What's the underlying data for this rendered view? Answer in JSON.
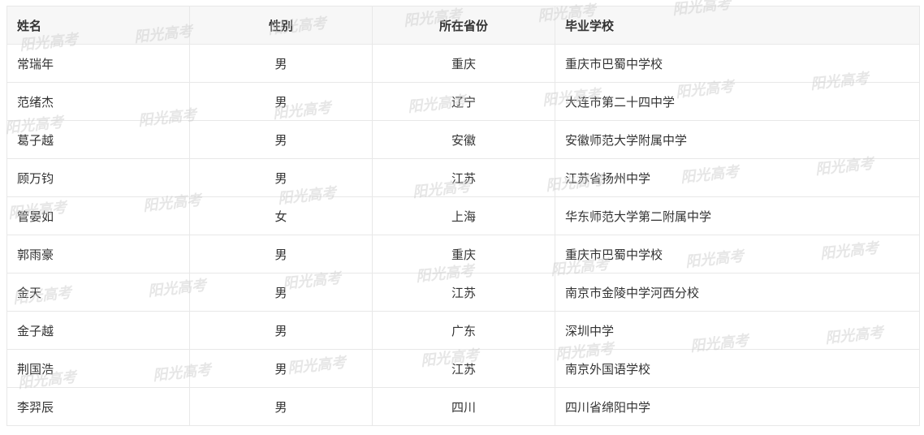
{
  "table": {
    "headers": {
      "name": "姓名",
      "gender": "性别",
      "province": "所在省份",
      "school": "毕业学校"
    },
    "rows": [
      {
        "name": "常瑞年",
        "gender": "男",
        "province": "重庆",
        "school": "重庆市巴蜀中学校"
      },
      {
        "name": "范绪杰",
        "gender": "男",
        "province": "辽宁",
        "school": "大连市第二十四中学"
      },
      {
        "name": "葛子越",
        "gender": "男",
        "province": "安徽",
        "school": "安徽师范大学附属中学"
      },
      {
        "name": "顾万钧",
        "gender": "男",
        "province": "江苏",
        "school": "江苏省扬州中学"
      },
      {
        "name": "管晏如",
        "gender": "女",
        "province": "上海",
        "school": "华东师范大学第二附属中学"
      },
      {
        "name": "郭雨豪",
        "gender": "男",
        "province": "重庆",
        "school": "重庆市巴蜀中学校"
      },
      {
        "name": "金天",
        "gender": "男",
        "province": "江苏",
        "school": "南京市金陵中学河西分校"
      },
      {
        "name": "金子越",
        "gender": "男",
        "province": "广东",
        "school": "深圳中学"
      },
      {
        "name": "荆国浩",
        "gender": "男",
        "province": "江苏",
        "school": "南京外国语学校"
      },
      {
        "name": "李羿辰",
        "gender": "男",
        "province": "四川",
        "school": "四川省绵阳中学"
      }
    ]
  },
  "watermark": {
    "text": "阳光高考"
  }
}
